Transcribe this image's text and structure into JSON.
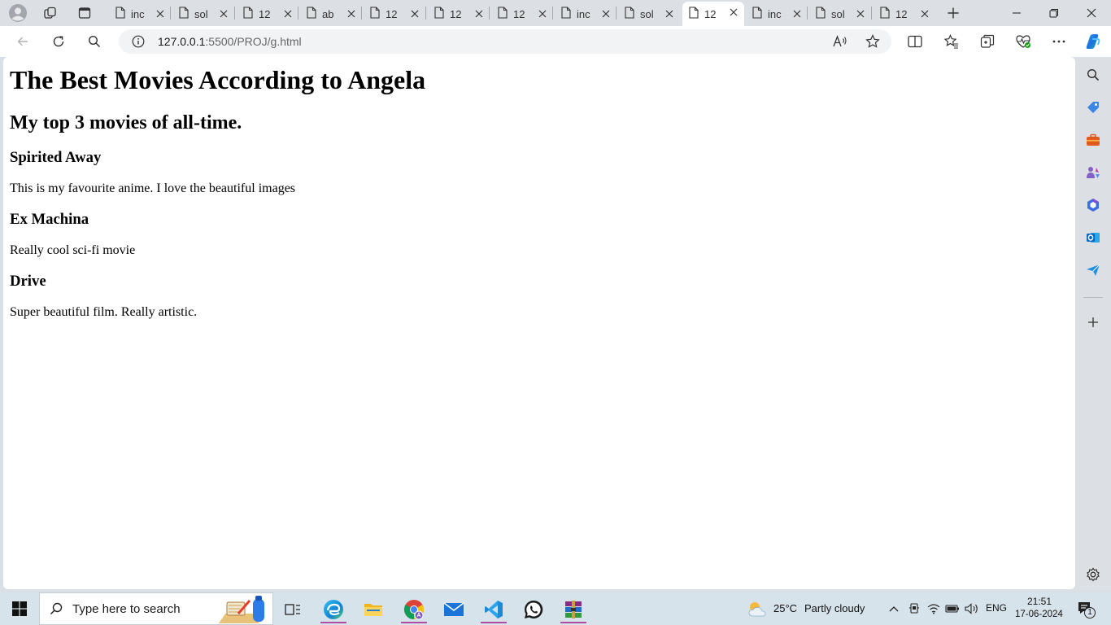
{
  "tabs": [
    {
      "label": "inc",
      "active": false
    },
    {
      "label": "sol",
      "active": false
    },
    {
      "label": "12",
      "active": false
    },
    {
      "label": "ab",
      "active": false
    },
    {
      "label": "12",
      "active": false
    },
    {
      "label": "12",
      "active": false
    },
    {
      "label": "12",
      "active": false
    },
    {
      "label": "inc",
      "active": false
    },
    {
      "label": "sol",
      "active": false
    },
    {
      "label": "12",
      "active": true
    },
    {
      "label": "inc",
      "active": false
    },
    {
      "label": "sol",
      "active": false
    },
    {
      "label": "12",
      "active": false
    }
  ],
  "address": {
    "host": "127.0.0.1",
    "rest": ":5500/PROJ/g.html"
  },
  "page": {
    "title": "The Best Movies According to Angela",
    "subtitle": "My top 3 movies of all-time.",
    "movies": [
      {
        "name": "Spirited Away",
        "description": "This is my favourite anime. I love the beautiful images"
      },
      {
        "name": "Ex Machina",
        "description": "Really cool sci-fi movie"
      },
      {
        "name": "Drive",
        "description": "Super beautiful film. Really artistic."
      }
    ]
  },
  "taskbar": {
    "search_placeholder": "Type here to search",
    "weather_temp": "25°C",
    "weather_condition": "Partly cloudy",
    "language": "ENG",
    "time": "21:51",
    "date": "17-06-2024",
    "notification_count": "1"
  },
  "colors": {
    "accent": "#0078d4",
    "taskbar": "#d7e3ea",
    "active_indicator": "#b04ca3"
  }
}
